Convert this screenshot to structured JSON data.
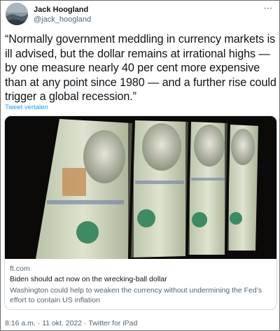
{
  "author": {
    "name": "Jack Hoogland",
    "handle": "@jack_hoogland"
  },
  "icons": {
    "more": "more-dots-icon",
    "avatar": "avatar-photo"
  },
  "tweet": {
    "text": "“Normally government meddling in currency markets is ill advised, but the dollar remains at irrational highs — by one measure nearly 40 per cent more expensive than at any point since 1980 — and a further rise could trigger a global recession.”",
    "translate_label": "Tweet vertalen"
  },
  "card": {
    "domain": "ft.com",
    "title": "Biden should act now on the wrecking-ball dollar",
    "description": "Washington could help to weaken the currency without undermining the Fed’s effort to contain US inflation"
  },
  "footer": {
    "time": "8:16 a.m.",
    "separator": "·",
    "date": "11 okt. 2022",
    "source": "Twitter for iPad"
  },
  "colors": {
    "link": "#1d9bf0",
    "text": "#0f1419",
    "secondary": "#536471",
    "border": "#cfd9de"
  }
}
